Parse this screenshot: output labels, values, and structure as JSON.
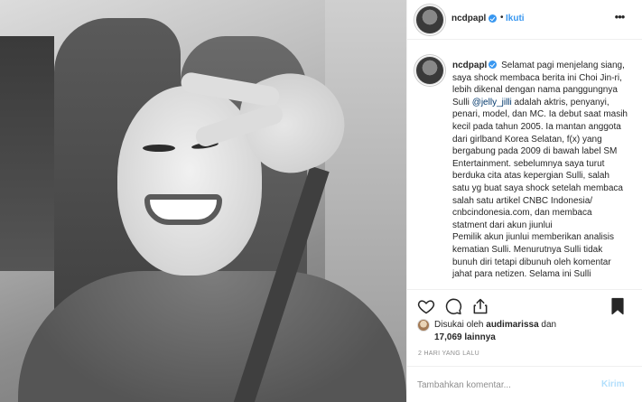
{
  "post": {
    "username": "ncdpapl",
    "separator": "•",
    "follow_label": "Ikuti",
    "more_icon": "more-options-icon"
  },
  "caption": {
    "username": "ncdpapl",
    "part1": "Selamat pagi menjelang siang, saya shock membaca berita ini Choi Jin-ri, lebih dikenal dengan nama panggungnya Sulli",
    "mention": "@jelly_jilli",
    "part2": "adalah aktris, penyanyi, penari, model, dan MC. Ia debut saat masih kecil pada tahun 2005. Ia mantan anggota dari girlband Korea Selatan, f(x) yang bergabung pada 2009 di bawah label SM Entertainment. sebelumnya saya turut berduka cita atas kepergian Sulli, salah satu yg buat saya shock setelah membaca salah satu artikel CNBC Indonesia/ cnbcindonesia.com, dan membaca statment dari akun jiunlui",
    "part3": "Pemilik akun jiunlui memberikan analisis kematian Sulli. Menurutnya Sulli tidak bunuh diri tetapi dibunuh oleh komentar jahat para netizen. Selama ini Sulli"
  },
  "likes": {
    "prefix": "Disukai oleh",
    "user": "audimarissa",
    "conjunction": "dan",
    "others": "17,069 lainnya"
  },
  "timestamp": "2 HARI YANG LALU",
  "comment_box": {
    "placeholder": "Tambahkan komentar...",
    "post_label": "Kirim"
  },
  "colors": {
    "accent": "#3897f0",
    "text": "#262626",
    "muted": "#8e8e8e",
    "post_disabled": "#b2dffc"
  }
}
